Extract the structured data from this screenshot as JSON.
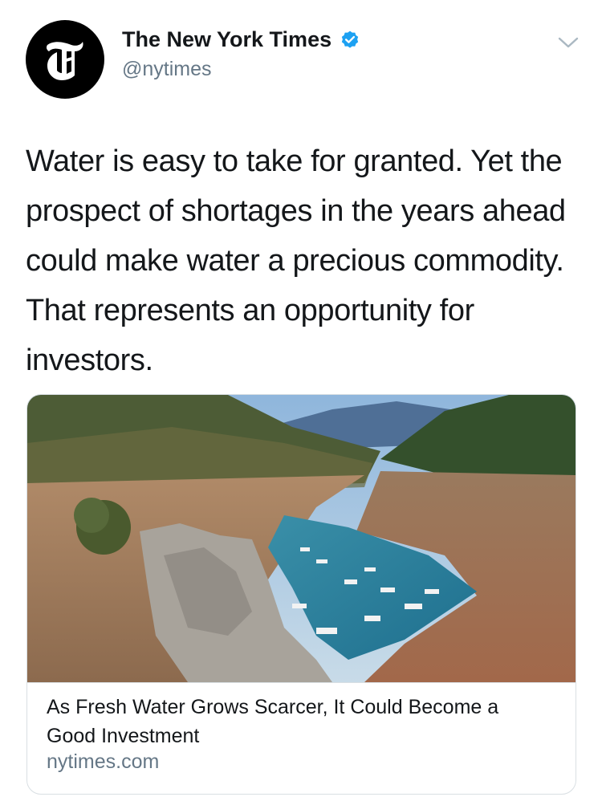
{
  "tweet": {
    "author": {
      "display_name": "The New York Times",
      "handle": "@nytimes",
      "verified": true,
      "avatar_icon": "nyt-logo-icon"
    },
    "menu_icon": "chevron-down-icon",
    "text": "Water is easy to take for granted. Yet the prospect of shortages in the years ahead could make water a precious commodity. That represents an opportunity for investors.",
    "card": {
      "image_icon": "reservoir-photo",
      "title": "As Fresh Water Grows Scarcer, It Could Become a Good Investment",
      "domain": "nytimes.com"
    }
  },
  "colors": {
    "text_primary": "#14171a",
    "text_secondary": "#657786",
    "verified_blue": "#1da1f2",
    "border": "#d9dfe3"
  }
}
